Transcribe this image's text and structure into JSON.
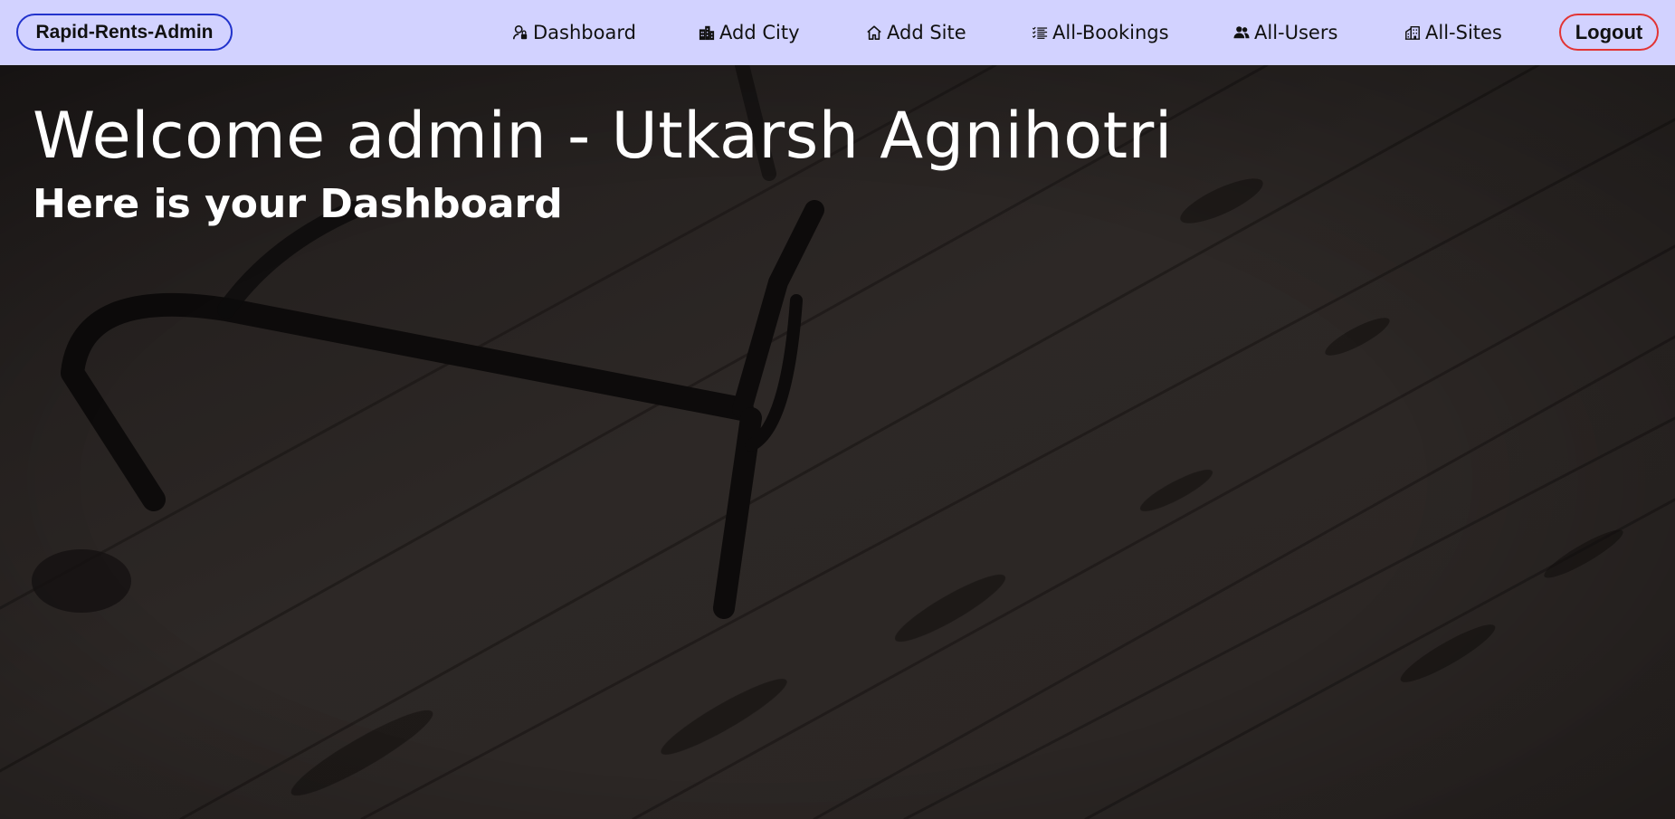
{
  "navbar": {
    "brand": "Rapid-Rents-Admin",
    "items": [
      {
        "label": "Dashboard",
        "icon": "user-lock-icon"
      },
      {
        "label": "Add City",
        "icon": "city-icon"
      },
      {
        "label": "Add Site",
        "icon": "home-icon"
      },
      {
        "label": "All-Bookings",
        "icon": "list-check-icon"
      },
      {
        "label": "All-Users",
        "icon": "users-icon"
      },
      {
        "label": "All-Sites",
        "icon": "buildings-icon"
      }
    ],
    "logout": "Logout"
  },
  "hero": {
    "welcome": "Welcome admin - Utkarsh Agnihotri",
    "subtitle": "Here is your Dashboard"
  },
  "colors": {
    "navbar_bg": "#d2d2ff",
    "brand_border": "#2233cc",
    "logout_border": "#e23434",
    "hero_text": "#ffffff"
  }
}
